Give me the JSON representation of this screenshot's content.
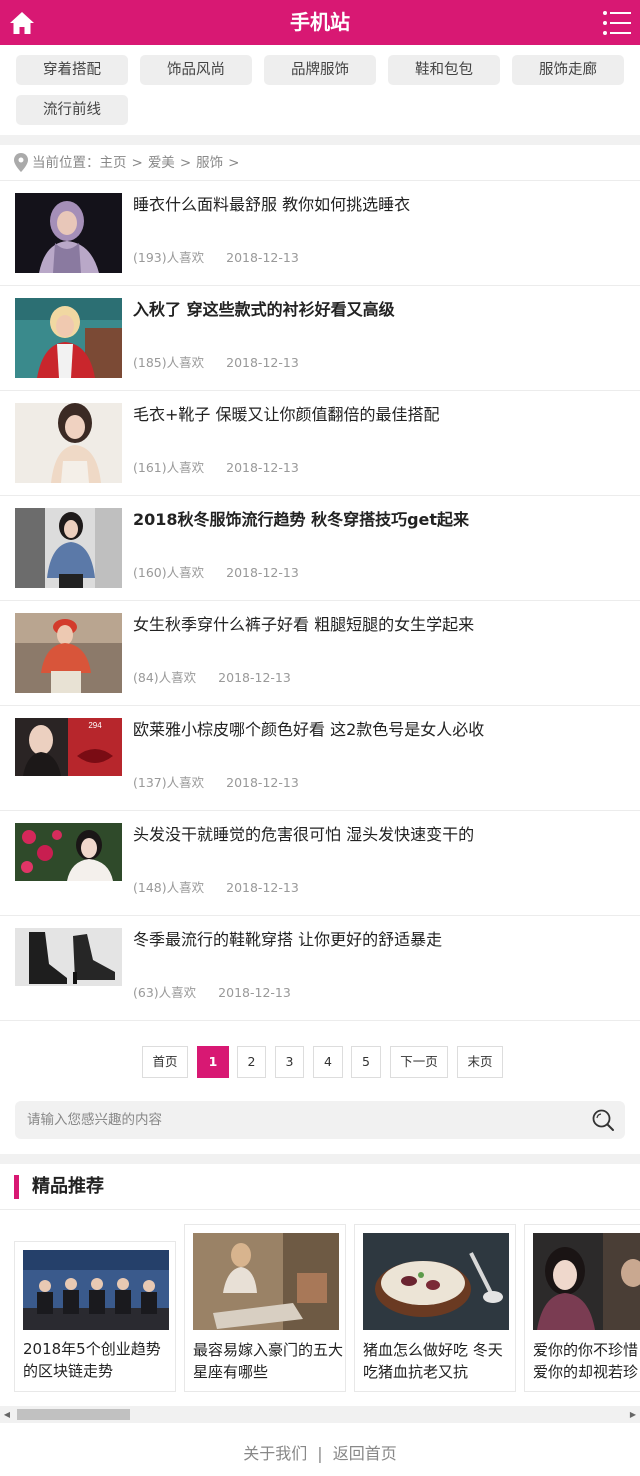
{
  "header": {
    "title": "手机站",
    "home_icon": "home-icon",
    "menu_icon": "menu-list-icon",
    "brand_color": "#d81873"
  },
  "categories": [
    "穿着搭配",
    "饰品风尚",
    "品牌服饰",
    "鞋和包包",
    "服饰走廊",
    "流行前线"
  ],
  "breadcrumb": {
    "label": "当前位置：",
    "items": [
      "主页",
      ">",
      "爱美",
      ">",
      "服饰",
      ">"
    ]
  },
  "articles": [
    {
      "title": "睡衣什么面料最舒服 教你如何挑选睡衣",
      "likes": "(193)人喜欢",
      "date": "2018-12-13",
      "bold": false
    },
    {
      "title": "入秋了 穿这些款式的衬衫好看又高级",
      "likes": "(185)人喜欢",
      "date": "2018-12-13",
      "bold": true
    },
    {
      "title": "毛衣+靴子 保暖又让你颜值翻倍的最佳搭配",
      "likes": "(161)人喜欢",
      "date": "2018-12-13",
      "bold": false
    },
    {
      "title": "2018秋冬服饰流行趋势 秋冬穿搭技巧get起来",
      "likes": "(160)人喜欢",
      "date": "2018-12-13",
      "bold": true
    },
    {
      "title": "女生秋季穿什么裤子好看 粗腿短腿的女生学起来",
      "likes": "(84)人喜欢",
      "date": "2018-12-13",
      "bold": false
    },
    {
      "title": "欧莱雅小棕皮哪个颜色好看 这2款色号是女人必收",
      "likes": "(137)人喜欢",
      "date": "2018-12-13",
      "bold": false
    },
    {
      "title": "头发没干就睡觉的危害很可怕 湿头发快速变干的",
      "likes": "(148)人喜欢",
      "date": "2018-12-13",
      "bold": false
    },
    {
      "title": "冬季最流行的鞋靴穿搭 让你更好的舒适暴走",
      "likes": "(63)人喜欢",
      "date": "2018-12-13",
      "bold": false
    }
  ],
  "lipstick_label": "294",
  "pagination": {
    "first": "首页",
    "pages": [
      "1",
      "2",
      "3",
      "4",
      "5"
    ],
    "current": "1",
    "next": "下一页",
    "last": "末页"
  },
  "search": {
    "placeholder": "请输入您感兴趣的内容",
    "icon": "search-icon"
  },
  "recommend": {
    "title": "精品推荐",
    "cards": [
      {
        "title": "2018年5个创业趋势的区块链走势"
      },
      {
        "title": "最容易嫁入豪门的五大星座有哪些"
      },
      {
        "title": "猪血怎么做好吃 冬天吃猪血抗老又抗"
      },
      {
        "title": "爱你的你不珍惜 爱你的却视若珍"
      }
    ]
  },
  "footer": {
    "about": "关于我们",
    "divider": "|",
    "home": "返回首页"
  }
}
